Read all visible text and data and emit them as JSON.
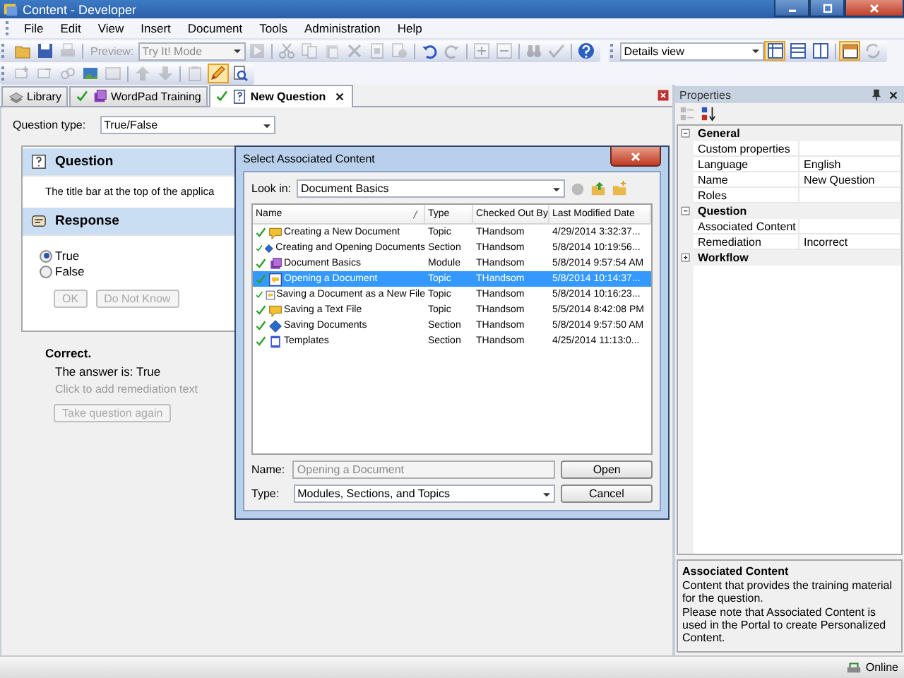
{
  "window": {
    "title": "Content - Developer"
  },
  "menu": [
    {
      "label": "File"
    },
    {
      "label": "Edit"
    },
    {
      "label": "View"
    },
    {
      "label": "Insert"
    },
    {
      "label": "Document"
    },
    {
      "label": "Tools"
    },
    {
      "label": "Administration"
    },
    {
      "label": "Help"
    }
  ],
  "toolbar_1": [
    {
      "kind": "button",
      "disabled": false,
      "pressed": false
    },
    {
      "kind": "button",
      "disabled": false,
      "pressed": false
    },
    {
      "kind": "button",
      "disabled": true,
      "pressed": false
    },
    {
      "kind": "separator"
    },
    {
      "kind": "label",
      "text": "Preview:",
      "disabled": true
    },
    {
      "kind": "dropdown",
      "value": "Try It! Mode",
      "disabled": true
    },
    {
      "kind": "button",
      "disabled": true,
      "pressed": false
    },
    {
      "kind": "separator"
    },
    {
      "kind": "button",
      "disabled": true,
      "pressed": false
    },
    {
      "kind": "button",
      "disabled": true,
      "pressed": false
    },
    {
      "kind": "button",
      "disabled": true,
      "pressed": false
    },
    {
      "kind": "button",
      "disabled": true,
      "pressed": false
    },
    {
      "kind": "button",
      "disabled": true,
      "pressed": false
    },
    {
      "kind": "button",
      "disabled": true,
      "pressed": false
    },
    {
      "kind": "separator"
    },
    {
      "kind": "button",
      "disabled": false,
      "pressed": false
    },
    {
      "kind": "button",
      "disabled": true,
      "pressed": false
    },
    {
      "kind": "separator"
    },
    {
      "kind": "button",
      "disabled": true,
      "pressed": false
    },
    {
      "kind": "button",
      "disabled": true,
      "pressed": false
    },
    {
      "kind": "separator"
    },
    {
      "kind": "button",
      "disabled": true,
      "pressed": false
    },
    {
      "kind": "button",
      "disabled": true,
      "pressed": false
    },
    {
      "kind": "separator"
    },
    {
      "kind": "button",
      "disabled": false,
      "pressed": false
    }
  ],
  "view_toolbar": [
    {
      "kind": "dropdown",
      "value": "Details view",
      "disabled": false
    },
    {
      "kind": "button",
      "disabled": false,
      "pressed": true
    },
    {
      "kind": "button",
      "disabled": false,
      "pressed": false
    },
    {
      "kind": "button",
      "disabled": false,
      "pressed": false
    },
    {
      "kind": "separator"
    },
    {
      "kind": "button",
      "disabled": false,
      "pressed": true
    },
    {
      "kind": "button",
      "disabled": true,
      "pressed": false
    }
  ],
  "toolbar_2": [
    {
      "kind": "button",
      "disabled": true,
      "pressed": false
    },
    {
      "kind": "button",
      "disabled": true,
      "pressed": false
    },
    {
      "kind": "button",
      "disabled": true,
      "pressed": false
    },
    {
      "kind": "button",
      "disabled": false,
      "pressed": false
    },
    {
      "kind": "button",
      "disabled": true,
      "pressed": false
    },
    {
      "kind": "separator"
    },
    {
      "kind": "button",
      "disabled": true,
      "pressed": false
    },
    {
      "kind": "button",
      "disabled": true,
      "pressed": false
    },
    {
      "kind": "separator"
    },
    {
      "kind": "button",
      "disabled": true,
      "pressed": false
    },
    {
      "kind": "button",
      "disabled": false,
      "pressed": true
    },
    {
      "kind": "button",
      "disabled": false,
      "pressed": false
    }
  ],
  "tabs": [
    {
      "label": "Library",
      "kind": "library",
      "selected": false,
      "checked": false,
      "closable": false
    },
    {
      "label": "WordPad Training",
      "kind": "module",
      "selected": false,
      "checked": true,
      "closable": false
    },
    {
      "label": "New Question",
      "kind": "question",
      "selected": true,
      "checked": true,
      "closable": true
    }
  ],
  "editor": {
    "question_type_label": "Question type:",
    "question_type": "True/False",
    "question": {
      "heading": "Question",
      "text": "The title bar at the top of the applica"
    },
    "response": {
      "heading": "Response",
      "options": [
        {
          "label": "True",
          "selected": true
        },
        {
          "label": "False",
          "selected": false
        }
      ],
      "buttons": [
        {
          "label": "OK",
          "disabled": true
        },
        {
          "label": "Do Not Know",
          "disabled": true
        }
      ]
    },
    "feedback": {
      "result": "Correct.",
      "answer": "The answer is: True",
      "remediation_hint": "Click to add remediation text",
      "retry_button": {
        "label": "Take question again",
        "disabled": true
      }
    }
  },
  "dialog": {
    "title": "Select Associated Content",
    "look_in_label": "Look in:",
    "look_in": "Document Basics",
    "columns": [
      "Name",
      "Type",
      "Checked Out By",
      "Last Modified Date"
    ],
    "rows": [
      {
        "kind": "topic",
        "name": "Creating a New Document",
        "type": "Topic",
        "checked_out_by": "THandsom",
        "modified": "4/29/2014 3:32:37...",
        "checked": true,
        "selected": false
      },
      {
        "kind": "section",
        "name": "Creating and Opening Documents",
        "type": "Section",
        "checked_out_by": "THandsom",
        "modified": "5/8/2014 10:19:56...",
        "checked": true,
        "selected": false
      },
      {
        "kind": "module",
        "name": "Document Basics",
        "type": "Module",
        "checked_out_by": "THandsom",
        "modified": "5/8/2014 9:57:54 AM",
        "checked": true,
        "selected": false
      },
      {
        "kind": "topic-page",
        "name": "Opening a Document",
        "type": "Topic",
        "checked_out_by": "THandsom",
        "modified": "5/8/2014 10:14:37...",
        "checked": true,
        "selected": true
      },
      {
        "kind": "topic-page",
        "name": "Saving a Document as a New File",
        "type": "Topic",
        "checked_out_by": "THandsom",
        "modified": "5/8/2014 10:16:23...",
        "checked": true,
        "selected": false
      },
      {
        "kind": "topic",
        "name": "Saving a Text File",
        "type": "Topic",
        "checked_out_by": "THandsom",
        "modified": "5/5/2014 8:42:08 PM",
        "checked": true,
        "selected": false
      },
      {
        "kind": "section",
        "name": "Saving Documents",
        "type": "Section",
        "checked_out_by": "THandsom",
        "modified": "5/8/2014 9:57:50 AM",
        "checked": true,
        "selected": false
      },
      {
        "kind": "template",
        "name": "Templates",
        "type": "Section",
        "checked_out_by": "THandsom",
        "modified": "4/25/2014 11:13:0...",
        "checked": true,
        "selected": false
      }
    ],
    "name_label": "Name:",
    "name_value": "Opening a Document",
    "type_label": "Type:",
    "type_value": "Modules, Sections, and Topics",
    "buttons": [
      "Open",
      "Cancel"
    ]
  },
  "properties": {
    "title": "Properties",
    "groups": [
      {
        "label": "General",
        "expanded": true,
        "rows": [
          {
            "name": "Custom properties"
          },
          {
            "name": "Language",
            "value": "English"
          },
          {
            "name": "Name",
            "value": "New Question"
          },
          {
            "name": "Roles"
          }
        ]
      },
      {
        "label": "Question",
        "expanded": true,
        "rows": [
          {
            "name": "Associated Content"
          },
          {
            "name": "Remediation",
            "value": "Incorrect"
          }
        ]
      },
      {
        "label": "Workflow",
        "expanded": false
      }
    ],
    "help": {
      "title": "Associated Content",
      "paragraphs": [
        "Content that provides the training material for the question.",
        "Please note that Associated Content is used in the Portal to create Personalized Content."
      ]
    }
  },
  "status_bar": {
    "text": "Online"
  }
}
